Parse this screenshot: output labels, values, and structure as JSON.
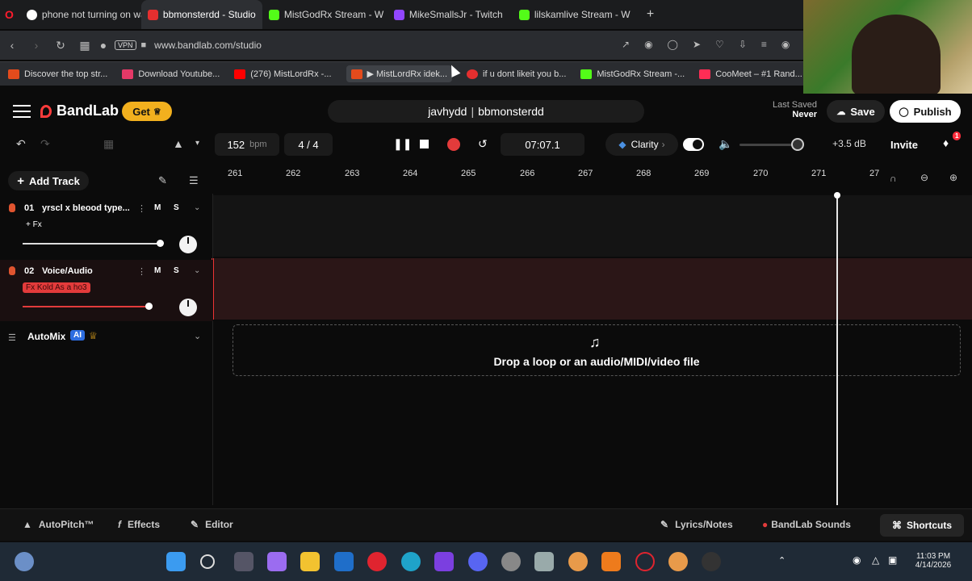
{
  "browser": {
    "tabs": [
      {
        "title": "phone not turning on wat",
        "color": "#ff3b30",
        "active": false
      },
      {
        "title": "bbmonsterdd - Studio",
        "color": "#e52f2f",
        "active": true
      },
      {
        "title": "MistGodRx Stream - W",
        "color": "#53fc18",
        "active": false
      },
      {
        "title": "MikeSmallsJr - Twitch",
        "color": "#9146ff",
        "active": false
      },
      {
        "title": "lilskamlive Stream - W",
        "color": "#53fc18",
        "active": false
      }
    ],
    "new_tab": "+",
    "url": "www.bandlab.com/studio",
    "vpn_label": "VPN",
    "bookmarks": [
      {
        "label": "Discover the top str...",
        "color": "#e44b1c"
      },
      {
        "label": "Download Youtube...",
        "color": "#e53967"
      },
      {
        "label": "(276) MistLordRx -...",
        "color": "#ff0000"
      },
      {
        "label": "▶ MistLordRx idek...",
        "color": "#e44b1c"
      },
      {
        "label": "if u dont likeit you b...",
        "color": "#e52f2f"
      },
      {
        "label": "MistGodRx Stream -...",
        "color": "#53fc18"
      },
      {
        "label": "CooMeet – #1 Rand...",
        "color": "#ff2d55"
      }
    ]
  },
  "app": {
    "brand": "BandLab",
    "get_label": "Get",
    "project_user": "javhydd",
    "project_owner": "bbmonsterdd",
    "last_saved_label": "Last Saved",
    "last_saved_value": "Never",
    "save_label": "Save",
    "publish_label": "Publish"
  },
  "transport": {
    "tempo": "152",
    "tempo_unit": "bpm",
    "time_signature": "4 / 4",
    "time": "07:07.1",
    "clarity_label": "Clarity",
    "volume_level": 0.8,
    "gain": "+3.5 dB",
    "invite_label": "Invite",
    "notifications": "1"
  },
  "timeline": {
    "add_track_label": "Add Track",
    "bars": [
      "261",
      "262",
      "263",
      "264",
      "265",
      "266",
      "267",
      "268",
      "269",
      "270",
      "271",
      "27"
    ],
    "drop_text": "Drop a loop or an audio/MIDI/video file"
  },
  "tracks": [
    {
      "number": "01",
      "name": "yrscl x bleood type...",
      "fx": "+ Fx",
      "mute": "M",
      "solo": "S",
      "volume": 1.0,
      "fx_active": false
    },
    {
      "number": "02",
      "name": "Voice/Audio",
      "fx": "Fx Kold As a ho3",
      "mute": "M",
      "solo": "S",
      "volume": 0.92,
      "fx_active": true
    }
  ],
  "automix": {
    "label": "AutoMix",
    "badge": "AI"
  },
  "bottom": {
    "autopitch": "AutoPitch™",
    "effects": "Effects",
    "editor": "Editor",
    "lyrics": "Lyrics/Notes",
    "sounds": "BandLab Sounds",
    "shortcuts": "Shortcuts"
  },
  "taskbar": {
    "time": "11:03 PM",
    "date": "4/14/2026"
  },
  "colors": {
    "accent_red": "#e33b3b",
    "get_yellow": "#f2b01e",
    "ai_blue": "#2d6de0"
  }
}
